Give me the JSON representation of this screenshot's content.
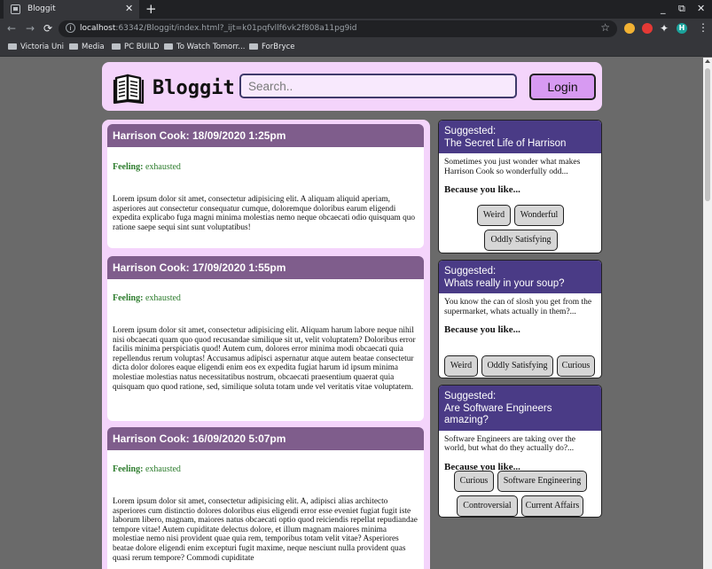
{
  "browser": {
    "tab_title": "Bloggit",
    "url_host": "localhost",
    "url_rest": ":63342/Bloggit/index.html?_ijt=k01pqfvllf6vk2f808a11pg9id",
    "bookmarks": [
      "Victoria Uni",
      "Media",
      "PC BUILD",
      "To Watch Tomorr...",
      "ForBryce"
    ],
    "profile_initial": "H"
  },
  "header": {
    "brand": "Bloggit",
    "search_placeholder": "Search..",
    "login_label": "Login"
  },
  "posts": [
    {
      "title": "Harrison Cook: 18/09/2020 1:25pm",
      "feeling_label": "Feeling:",
      "feeling": "exhausted",
      "body": "Lorem ipsum dolor sit amet, consectetur adipisicing elit. A aliquam aliquid aperiam, asperiores aut consectetur consequatur cumque, doloremque doloribus earum eligendi expedita explicabo fuga magni minima molestias nemo neque obcaecati odio quisquam quo ratione saepe sequi sint sunt voluptatibus!"
    },
    {
      "title": "Harrison Cook: 17/09/2020 1:55pm",
      "feeling_label": "Feeling:",
      "feeling": "exhausted",
      "body": "Lorem ipsum dolor sit amet, consectetur adipisicing elit. Aliquam harum labore neque nihil nisi obcaecati quam quo quod recusandae similique sit ut, velit voluptatem? Doloribus error facilis minima perspiciatis quod! Autem cum, dolores error minima modi obcaecati quia repellendus rerum voluptas! Accusamus adipisci aspernatur atque autem beatae consectetur dicta dolor dolores eaque eligendi enim eos ex expedita fugiat harum id ipsum minima molestiae molestias natus necessitatibus nostrum, obcaecati praesentium quaerat quia quisquam quo quod ratione, sed, similique soluta totam unde vel veritatis vitae voluptatem."
    },
    {
      "title": "Harrison Cook: 16/09/2020 5:07pm",
      "feeling_label": "Feeling:",
      "feeling": "exhausted",
      "body": "Lorem ipsum dolor sit amet, consectetur adipisicing elit. A, adipisci alias architecto asperiores cum distinctio dolores doloribus eius eligendi error esse eveniet fugiat fugit iste laborum libero, magnam, maiores natus obcaecati optio quod reiciendis repellat repudiandae tempore vitae! Autem cupiditate delectus dolore, et illum magnam maiores minima molestiae nemo nisi provident quae quia rem, temporibus totam velit vitae? Asperiores beatae dolore eligendi enim excepturi fugit maxime, neque nesciunt nulla provident quas quasi rerum tempore? Commodi cupiditate"
    }
  ],
  "suggestions": [
    {
      "kicker": "Suggested:",
      "title": "The Secret Life of Harrison",
      "desc": "Sometimes you just wonder what makes Harrison Cook so wonderfully odd...",
      "because": "Because you like...",
      "tags": [
        "Weird",
        "Wonderful",
        "Oddly Satisfying"
      ]
    },
    {
      "kicker": "Suggested:",
      "title": "Whats really in your soup?",
      "desc": "You know the can of slosh you get from the supermarket, whats actually in them?...",
      "because": "Because you like...",
      "tags": [
        "Weird",
        "Oddly Satisfying",
        "Curious"
      ]
    },
    {
      "kicker": "Suggested:",
      "title": "Are Software Engineers amazing?",
      "desc": "Software Engineers are taking over the world, but what do they actually do?...",
      "because": "Because you like...",
      "tags": [
        "Curious",
        "Software Engineering",
        "Controversial",
        "Current Affairs"
      ]
    }
  ]
}
